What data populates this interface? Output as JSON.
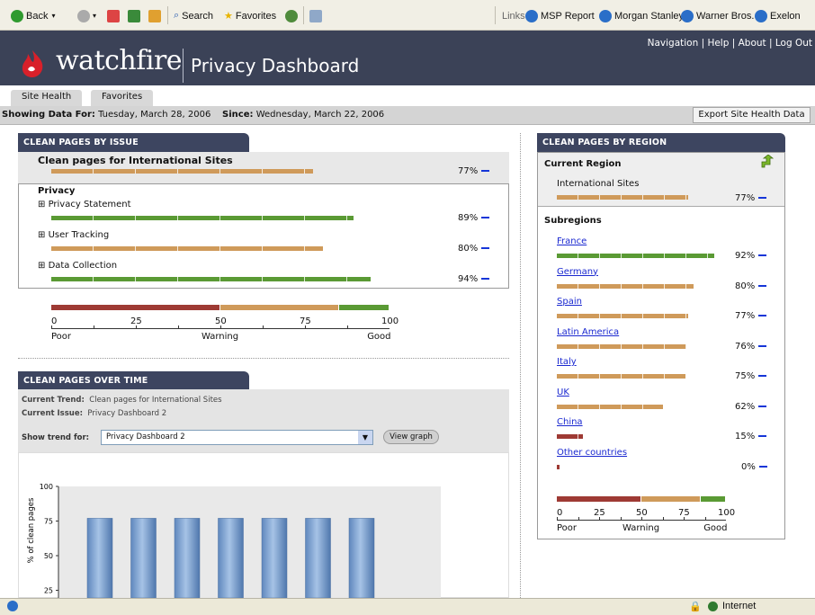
{
  "browser": {
    "back": "Back",
    "search": "Search",
    "favorites": "Favorites",
    "links_label": "Links",
    "links": [
      "MSP Report",
      "Morgan Stanley",
      "Warner Bros.",
      "Exelon"
    ],
    "status_zone": "Internet"
  },
  "header": {
    "logo": "watchfire",
    "title": "Privacy Dashboard",
    "nav": "Navigation | Help | About | Log Out"
  },
  "tabs": [
    "Site Health",
    "Favorites"
  ],
  "info": {
    "showing_label": "Showing Data For:",
    "showing_value": "Tuesday, March 28, 2006",
    "since_label": "Since:",
    "since_value": "Wednesday, March 22, 2006",
    "export": "Export Site Health Data"
  },
  "by_issue": {
    "title": "CLEAN PAGES BY ISSUE",
    "summary_label": "Clean pages for International Sites",
    "summary_pct": "77%",
    "summary_value": 77,
    "group": "Privacy",
    "items": [
      {
        "label": "Privacy Statement",
        "pct": "89%",
        "value": 89
      },
      {
        "label": "User Tracking",
        "pct": "80%",
        "value": 80
      },
      {
        "label": "Data Collection",
        "pct": "94%",
        "value": 94
      }
    ],
    "scale_ticks": [
      "0",
      "25",
      "50",
      "75",
      "100"
    ],
    "scale_words": [
      "Poor",
      "Warning",
      "Good"
    ]
  },
  "over_time": {
    "title": "CLEAN PAGES OVER TIME",
    "trend_label": "Current Trend:",
    "trend_value": "Clean pages for International Sites",
    "issue_label": "Current Issue:",
    "issue_value": "Privacy Dashboard 2",
    "show_label": "Show trend for:",
    "select_value": "Privacy Dashboard 2",
    "view_button": "View graph"
  },
  "chart_data": {
    "type": "bar",
    "ylabel": "% of clean pages",
    "y_ticks": [
      "100",
      "75",
      "50",
      "25"
    ],
    "ylim": [
      0,
      100
    ],
    "values": [
      77,
      77,
      77,
      77,
      77,
      77,
      77
    ],
    "color": "#7fa3cf"
  },
  "by_region": {
    "title": "CLEAN PAGES BY REGION",
    "current_label": "Current Region",
    "current_name": "International Sites",
    "current_pct": "77%",
    "current_value": 77,
    "subregions_label": "Subregions",
    "regions": [
      {
        "name": "France",
        "pct": "92%",
        "value": 92
      },
      {
        "name": "Germany",
        "pct": "80%",
        "value": 80
      },
      {
        "name": "Spain",
        "pct": "77%",
        "value": 77
      },
      {
        "name": "Latin America",
        "pct": "76%",
        "value": 76
      },
      {
        "name": "Italy",
        "pct": "75%",
        "value": 75
      },
      {
        "name": "UK",
        "pct": "62%",
        "value": 62
      },
      {
        "name": "China",
        "pct": "15%",
        "value": 15
      },
      {
        "name": "Other countries",
        "pct": "0%",
        "value": 0
      }
    ],
    "scale_ticks": [
      "0",
      "25",
      "50",
      "75",
      "100"
    ],
    "scale_words": [
      "Poor",
      "Warning",
      "Good"
    ]
  },
  "colors": {
    "good": "#5a9a34",
    "warning": "#cf9a5a",
    "poor": "#9e3a34",
    "header": "#3b4257"
  }
}
